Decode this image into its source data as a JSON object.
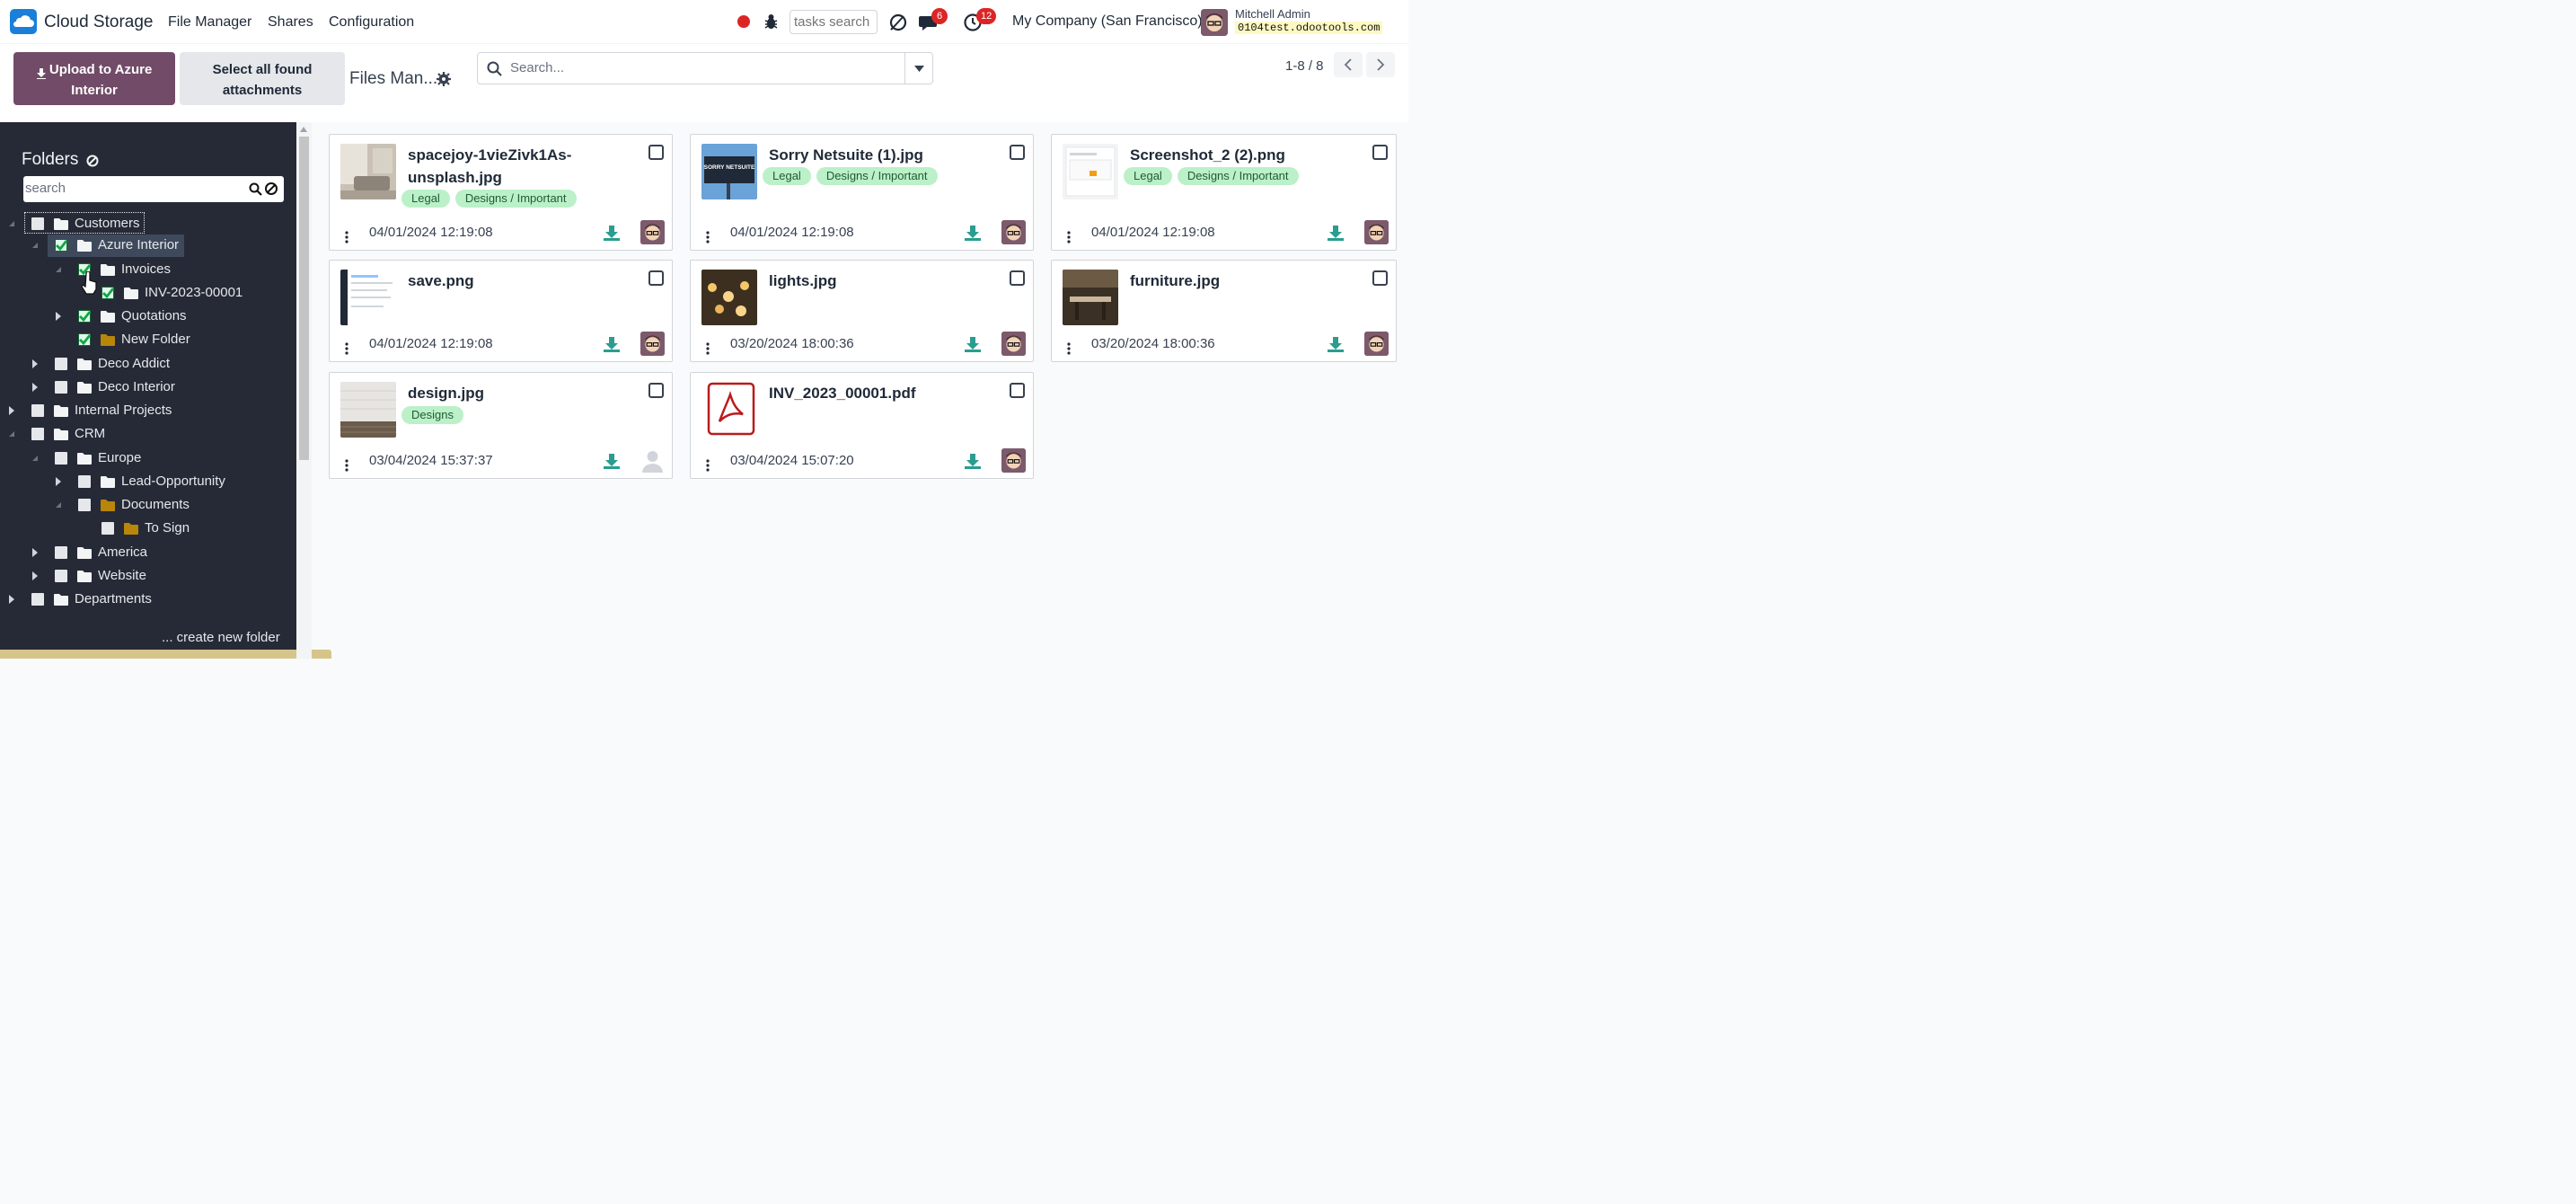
{
  "navbar": {
    "app_name": "Cloud Storage",
    "menu": [
      "File Manager",
      "Shares",
      "Configuration"
    ],
    "tasks_placeholder": "tasks search",
    "messages_count": "6",
    "activities_count": "12",
    "company": "My Company (San Francisco)",
    "user_name": "Mitchell Admin",
    "database": "0104test.odootools.com"
  },
  "control_panel": {
    "upload_button": "Upload to Azure Interior",
    "select_all_button": "Select all found attachments",
    "breadcrumb": "Files Man...",
    "search_placeholder": "Search...",
    "pager": "1-8 / 8"
  },
  "sidebar": {
    "title": "Folders",
    "search_placeholder": "search",
    "tree": [
      {
        "label": "Customers",
        "checked": false
      },
      {
        "label": "Azure Interior",
        "checked": true
      },
      {
        "label": "Invoices",
        "checked": true
      },
      {
        "label": "INV-2023-00001",
        "checked": true
      },
      {
        "label": "Quotations",
        "checked": true
      },
      {
        "label": "New Folder",
        "checked": true
      },
      {
        "label": "Deco Addict",
        "checked": false
      },
      {
        "label": "Deco Interior",
        "checked": false
      },
      {
        "label": "Internal Projects",
        "checked": false
      },
      {
        "label": "CRM",
        "checked": false
      },
      {
        "label": "Europe",
        "checked": false
      },
      {
        "label": "Lead-Opportunity",
        "checked": false
      },
      {
        "label": "Documents",
        "checked": false
      },
      {
        "label": "To Sign",
        "checked": false
      },
      {
        "label": "America",
        "checked": false
      },
      {
        "label": "Website",
        "checked": false
      },
      {
        "label": "Departments",
        "checked": false
      }
    ],
    "create_folder": "... create new folder"
  },
  "files": [
    {
      "name": "spacejoy-1vieZivk1As-unsplash.jpg",
      "name_line1": "spacejoy-1vieZivk1As-",
      "name_line2": "unsplash.jpg",
      "tags": [
        "Legal",
        "Designs / Important"
      ],
      "date": "04/01/2024 12:19:08"
    },
    {
      "name": "Sorry Netsuite (1).jpg",
      "tags": [
        "Legal",
        "Designs / Important"
      ],
      "date": "04/01/2024 12:19:08",
      "thumb_text": "SORRY NETSUITE"
    },
    {
      "name": "Screenshot_2 (2).png",
      "tags": [
        "Legal",
        "Designs / Important"
      ],
      "date": "04/01/2024 12:19:08"
    },
    {
      "name": "save.png",
      "tags": [],
      "date": "04/01/2024 12:19:08"
    },
    {
      "name": "lights.jpg",
      "tags": [],
      "date": "03/20/2024 18:00:36"
    },
    {
      "name": "furniture.jpg",
      "tags": [],
      "date": "03/20/2024 18:00:36"
    },
    {
      "name": "design.jpg",
      "tags": [
        "Designs"
      ],
      "date": "03/04/2024 15:37:37"
    },
    {
      "name": "INV_2023_00001.pdf",
      "tags": [],
      "date": "03/04/2024 15:07:20"
    }
  ],
  "colors": {
    "primary": "#714b67",
    "sidebar_bg": "#262a36",
    "tag_bg": "#bbf0c8",
    "download_icon": "#2a9d8f",
    "badge": "#dc2626"
  }
}
